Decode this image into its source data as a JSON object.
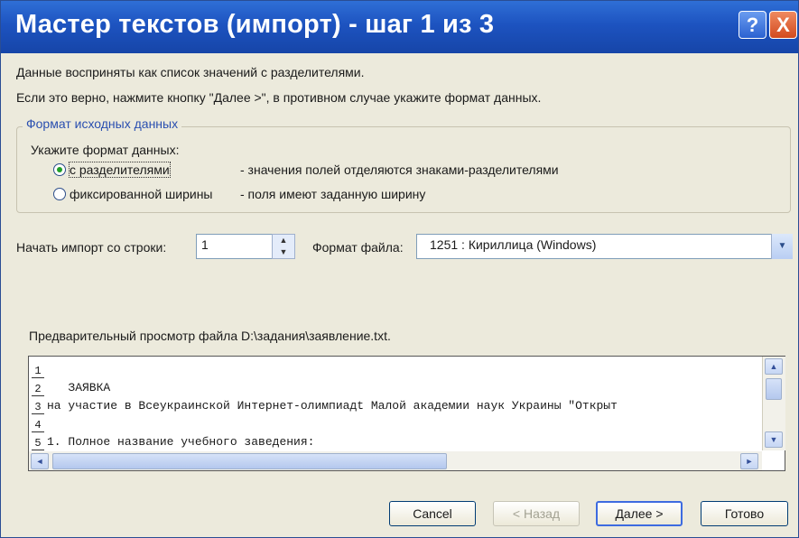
{
  "window": {
    "title": "Мастер текстов (импорт) - шаг 1 из 3",
    "help_symbol": "?",
    "close_symbol": "X"
  },
  "intro": {
    "line1": "Данные восприняты как список значений с разделителями.",
    "line2": "Если это верно, нажмите кнопку \"Далее >\", в противном случае укажите формат данных."
  },
  "format_group": {
    "title": "Формат исходных данных",
    "prompt": "Укажите формат данных:",
    "options": [
      {
        "label": "с разделителями",
        "desc": "- значения полей отделяются знаками-разделителями",
        "selected": true
      },
      {
        "label": "фиксированной ширины",
        "desc": "- поля имеют заданную ширину",
        "selected": false
      }
    ]
  },
  "import": {
    "start_label": "Начать импорт со строки:",
    "start_value": "1",
    "file_format_label": "Формат файла:",
    "file_format_value": "1251 : Кириллица (Windows)"
  },
  "preview": {
    "label": "Предварительный просмотр файла D:\\задания\\заявление.txt.",
    "rows": [
      {
        "num": "1",
        "text": ""
      },
      {
        "num": "2",
        "text": "   ЗАЯВКА"
      },
      {
        "num": "3",
        "text": "на участие в Всеукраинской Интернет-олимпиадt Малой академии наук Украины \"Открыт"
      },
      {
        "num": "4",
        "text": ""
      },
      {
        "num": "5",
        "text": "1. Полное название учебного заведения:"
      }
    ]
  },
  "buttons": {
    "cancel": "Cancel",
    "back": "< Назад",
    "next": "Далее >",
    "finish": "Готово"
  },
  "colors": {
    "title_bar": "#1d53c0",
    "group_title": "#2a4fb0",
    "radio_selected": "#1f9f28"
  }
}
